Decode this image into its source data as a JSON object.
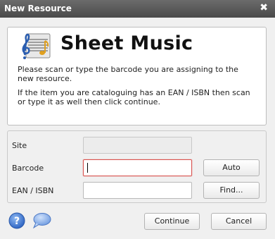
{
  "window": {
    "title": "New Resource",
    "close_glyph": "✖"
  },
  "header": {
    "icon": "sheet-music-icon",
    "title": "Sheet Music",
    "line1": "Please scan or type the barcode you are assigning to the new resource.",
    "line2": "If the item you are cataloguing has an EAN / ISBN then scan or type it as well then click continue."
  },
  "form": {
    "site_label": "Site",
    "site_value": "",
    "barcode_label": "Barcode",
    "barcode_value": "",
    "ean_label": "EAN / ISBN",
    "ean_value": "",
    "auto_button": "Auto",
    "find_button": "Find..."
  },
  "footer": {
    "help_icon": "help-icon",
    "chat_icon": "chat-icon",
    "continue_button": "Continue",
    "cancel_button": "Cancel"
  },
  "colors": {
    "titlebar": "#555555",
    "active_field_border": "#d9534f",
    "help_blue": "#3a7bd5"
  }
}
